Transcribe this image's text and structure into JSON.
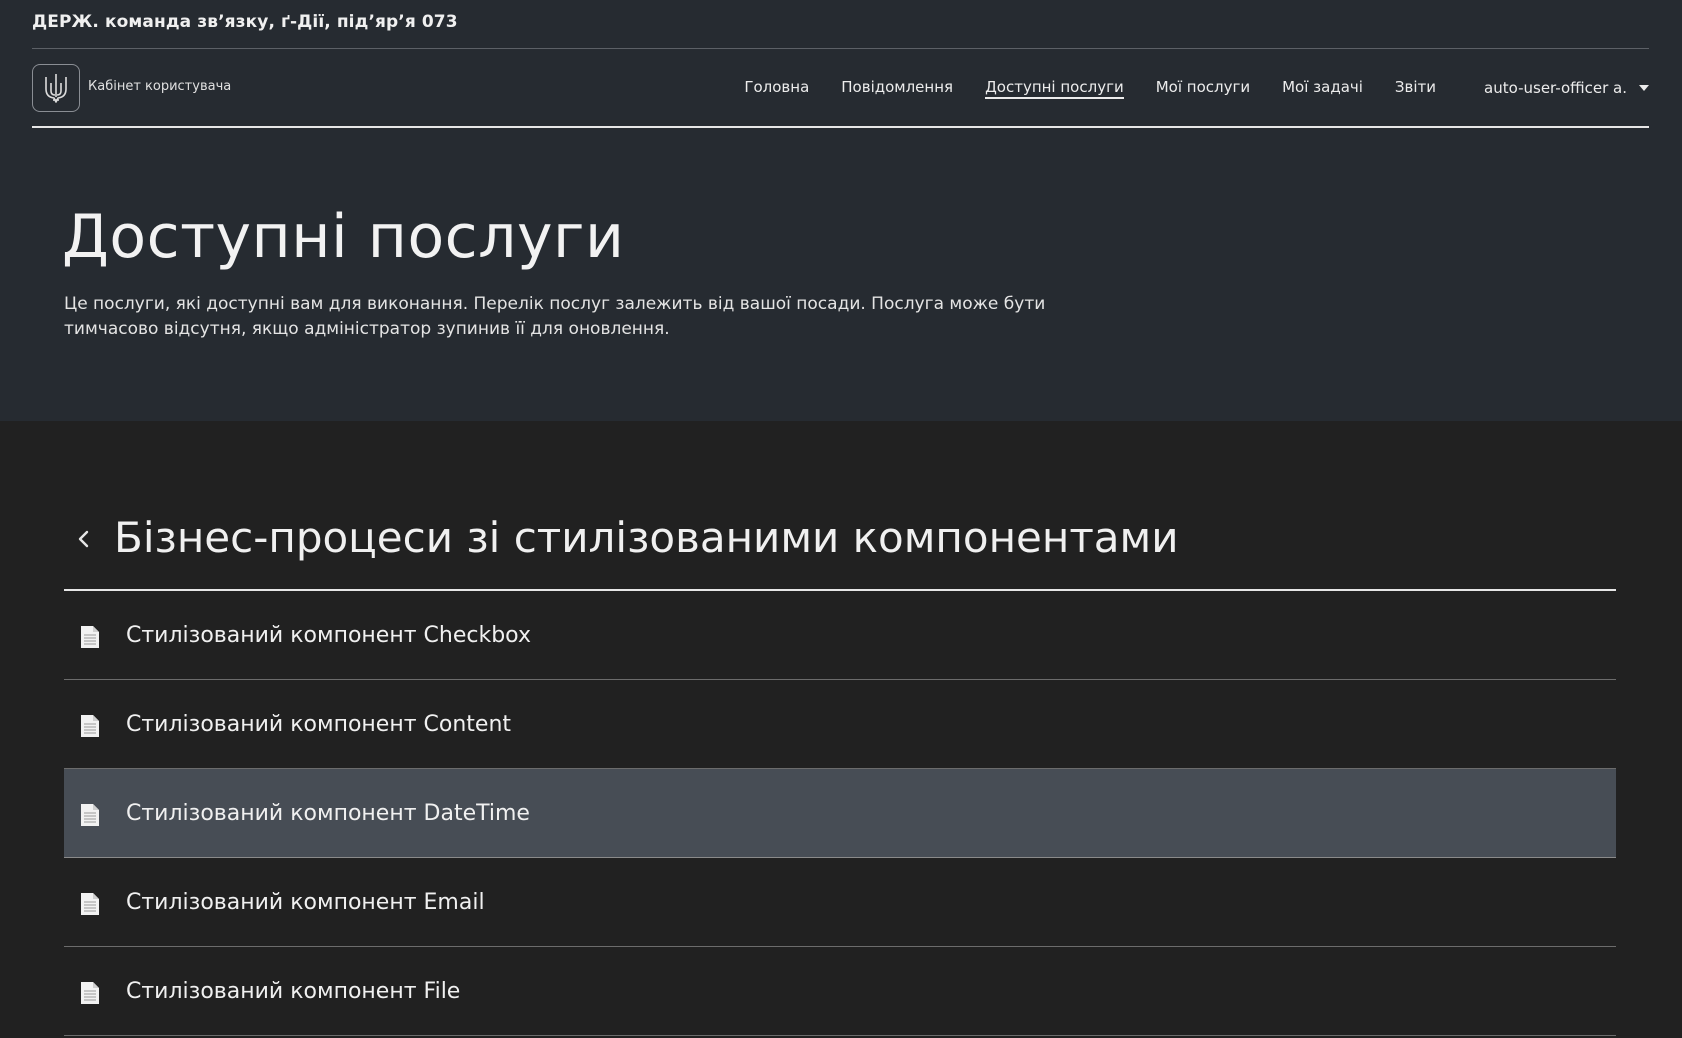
{
  "org": {
    "name": "ДЕРЖ. команда зв’язку, ґ-Дії, під’яр’я 073"
  },
  "brand": {
    "logo_icon": "trident-icon",
    "cabinet_label": "Кабінет користувача"
  },
  "nav": {
    "items": [
      {
        "label": "Головна",
        "active": false
      },
      {
        "label": "Повідомлення",
        "active": false
      },
      {
        "label": "Доступні послуги",
        "active": true
      },
      {
        "label": "Мої послуги",
        "active": false
      },
      {
        "label": "Мої задачі",
        "active": false
      },
      {
        "label": "Звіти",
        "active": false
      }
    ],
    "user": {
      "name": "auto-user-officer a.",
      "icon": "caret-down-icon"
    }
  },
  "page": {
    "title": "Доступні послуги",
    "description": "Це послуги, які доступні вам для виконання. Перелік послуг залежить від вашої посади. Послуга може бути тимчасово відсутня, якщо адміністратор зупинив її для оновлення."
  },
  "section": {
    "back_icon": "chevron-left-icon",
    "title": "Бізнес-процеси зі стилізованими компонентами"
  },
  "services": {
    "icon": "document-icon",
    "items": [
      {
        "label": "Стилізований компонент Checkbox",
        "hovered": false
      },
      {
        "label": "Стилізований компонент Content",
        "hovered": false
      },
      {
        "label": "Стилізований компонент DateTime",
        "hovered": true
      },
      {
        "label": "Стилізований компонент Email",
        "hovered": false
      },
      {
        "label": "Стилізований компонент File",
        "hovered": false
      }
    ]
  },
  "colors": {
    "header_bg": "#262b31",
    "content_bg": "#212121",
    "hover_row_bg": "#474d55",
    "text": "#f0f0f0"
  }
}
